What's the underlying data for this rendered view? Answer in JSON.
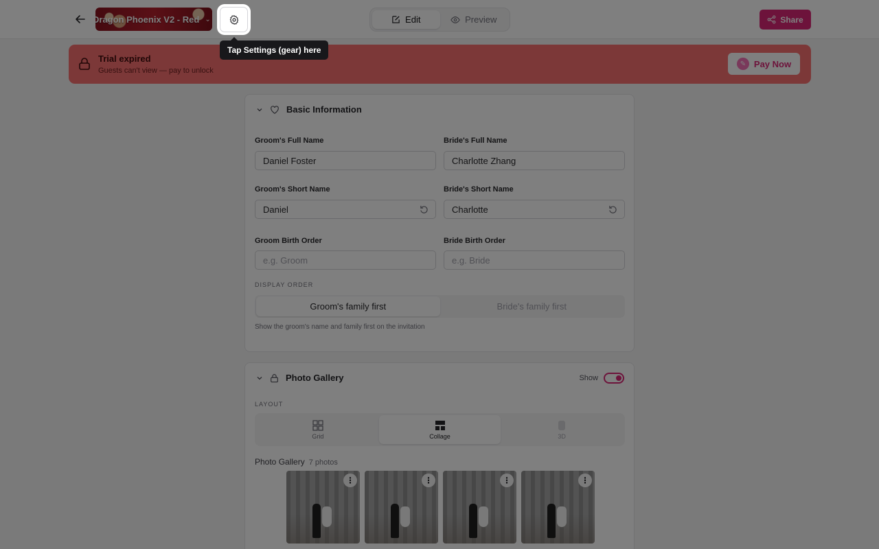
{
  "header": {
    "template_name": "Dragon Phoenix V2 - Red",
    "modes": [
      {
        "label": "Edit",
        "icon": "edit-icon"
      },
      {
        "label": "Preview",
        "icon": "eye-icon"
      }
    ],
    "share_label": "Share"
  },
  "tooltip": {
    "text": "Tap Settings (gear) here"
  },
  "banner": {
    "title": "Trial expired",
    "subtitle": "Guests can't view — pay to unlock",
    "pay_label": "Pay Now"
  },
  "basic_info": {
    "title": "Basic Information",
    "groom_full_label": "Groom's Full Name",
    "groom_full_value": "Daniel Foster",
    "bride_full_label": "Bride's Full Name",
    "bride_full_value": "Charlotte Zhang",
    "groom_short_label": "Groom's Short Name",
    "groom_short_value": "Daniel",
    "bride_short_label": "Bride's Short Name",
    "bride_short_value": "Charlotte",
    "groom_order_label": "Groom Birth Order",
    "groom_order_placeholder": "e.g. Groom",
    "bride_order_label": "Bride Birth Order",
    "bride_order_placeholder": "e.g. Bride",
    "display_order_caption": "DISPLAY ORDER",
    "order_options": [
      "Groom's family first",
      "Bride's family first"
    ],
    "order_help": "Show the groom's name and family first on the invitation"
  },
  "gallery": {
    "title": "Photo Gallery",
    "show_label": "Show",
    "layout_caption": "LAYOUT",
    "layouts": [
      "Grid",
      "Collage",
      "3D"
    ],
    "list_title": "Photo Gallery",
    "photo_count": "7 photos"
  },
  "colors": {
    "accent": "#db2777",
    "banner": "#f87171"
  }
}
